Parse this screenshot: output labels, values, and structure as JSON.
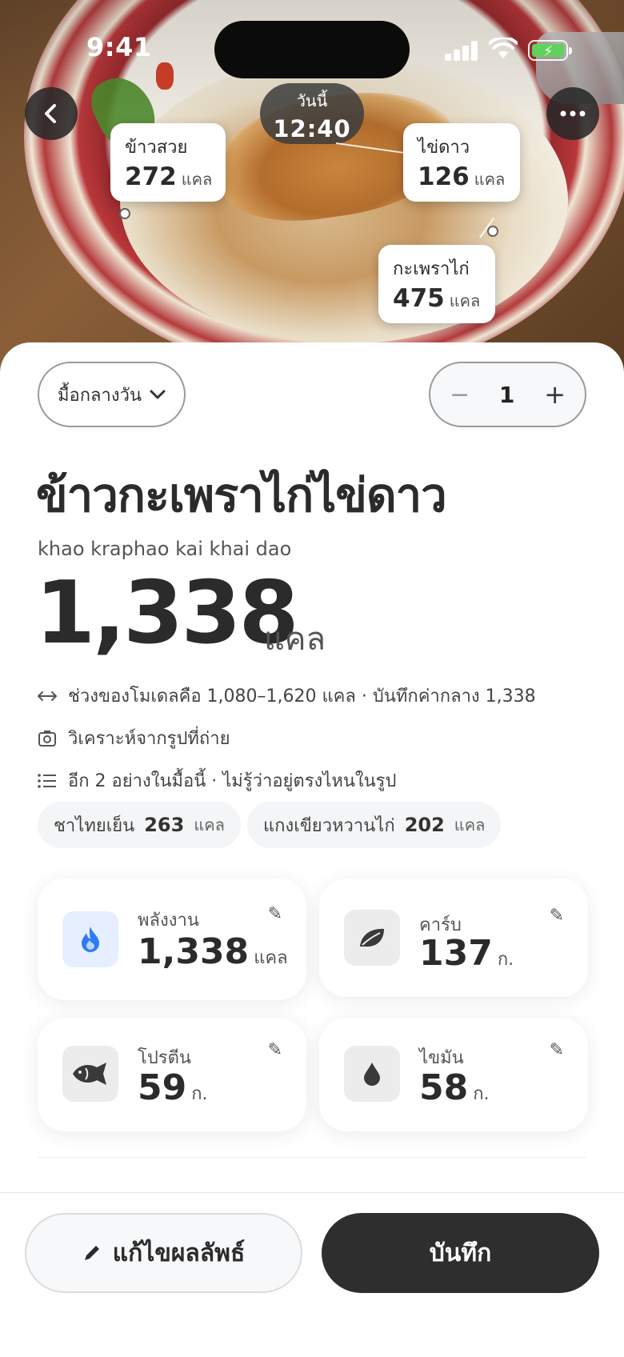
{
  "status_bar": {
    "time": "9:41"
  },
  "photo": {
    "time_chip": {
      "day": "วันนี้",
      "time": "12:40"
    },
    "tags": [
      {
        "name": "ข้าวสวย",
        "value": "272",
        "unit": "แคล"
      },
      {
        "name": "ไข่ดาว",
        "value": "126",
        "unit": "แคล"
      },
      {
        "name": "กะเพราไก่",
        "value": "475",
        "unit": "แคล"
      }
    ]
  },
  "controls": {
    "meal": "มื้อกลางวัน",
    "quantity": "1",
    "minus": "−",
    "plus": "+"
  },
  "dish": {
    "title": "ข้าวกะเพราไก่ไข่ดาว",
    "transliteration": "khao kraphao kai khai dao",
    "calories": "1,338",
    "calories_unit": "แคล"
  },
  "info": [
    {
      "icon": "range-arrows-icon",
      "text": "ช่วงของโมเดลคือ 1,080–1,620 แคล · บันทึกค่ากลาง 1,338"
    },
    {
      "icon": "camera-scan-icon",
      "text": "วิเคราะห์จากรูปที่ถ่าย"
    },
    {
      "icon": "list-icon",
      "text": "อีก 2 อย่างในมื้อนี้ · ไม่รู้ว่าอยู่ตรงไหนในรูป"
    }
  ],
  "extra_items": [
    {
      "name": "ชาไทยเย็น",
      "value": "263",
      "unit": "แคล"
    },
    {
      "name": "แกงเขียวหวานไก่",
      "value": "202",
      "unit": "แคล"
    }
  ],
  "nutrients": [
    {
      "label": "พลังงาน",
      "value": "1,338",
      "unit": "แคล",
      "icon": "flame-icon"
    },
    {
      "label": "คาร์บ",
      "value": "137",
      "unit": "ก.",
      "icon": "leaf-icon"
    },
    {
      "label": "โปรตีน",
      "value": "59",
      "unit": "ก.",
      "icon": "fish-icon"
    },
    {
      "label": "ไขมัน",
      "value": "58",
      "unit": "ก.",
      "icon": "droplet-icon"
    }
  ],
  "actions": {
    "edit": "แก้ไขผลลัพธ์",
    "save": "บันทึก"
  },
  "colors": {
    "primary_dark": "#2e2e2e",
    "energy_icon_bg": "#e6efff",
    "energy_icon": "#2f7bf6",
    "icon_box_bg": "#ececec"
  }
}
